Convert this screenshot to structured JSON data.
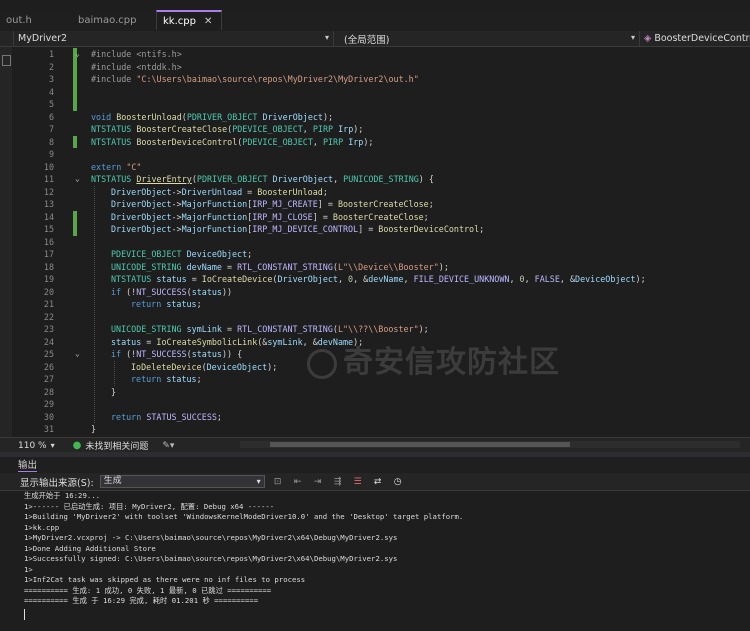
{
  "tabs": [
    {
      "label": "out.h",
      "active": false
    },
    {
      "label": "baimao.cpp",
      "active": false
    },
    {
      "label": "kk.cpp",
      "active": true
    }
  ],
  "navbar": {
    "project": "MyDriver2",
    "scope": "(全局范围)",
    "member": "BoosterDeviceControl"
  },
  "code_lines": [
    {
      "n": "1",
      "changed": true,
      "fold": "-",
      "indent": 0,
      "html": "<span class='pp'>#include &lt;ntifs.h&gt;</span>"
    },
    {
      "n": "2",
      "changed": true,
      "fold": "",
      "indent": 0,
      "html": "<span class='pp'>#include &lt;ntddk.h&gt;</span>"
    },
    {
      "n": "3",
      "changed": true,
      "fold": "",
      "indent": 0,
      "html": "<span class='pp'>#include </span><span class='str'>\"C:\\Users\\baimao\\source\\repos\\MyDriver2\\MyDriver2\\out.h\"</span>"
    },
    {
      "n": "4",
      "changed": true,
      "fold": "",
      "indent": 0,
      "html": ""
    },
    {
      "n": "5",
      "changed": true,
      "fold": "",
      "indent": 0,
      "html": ""
    },
    {
      "n": "6",
      "changed": false,
      "fold": "",
      "indent": 0,
      "html": "<span class='kw'>void</span> <span class='fn'>BoosterUnload</span>(<span class='ty'>PDRIVER_OBJECT</span> <span class='par'>DriverObject</span>);"
    },
    {
      "n": "7",
      "changed": false,
      "fold": "",
      "indent": 0,
      "html": "<span class='ty'>NTSTATUS</span> <span class='fn'>BoosterCreateClose</span>(<span class='ty'>PDEVICE_OBJECT</span>, <span class='ty'>PIRP</span> <span class='par'>Irp</span>);"
    },
    {
      "n": "8",
      "changed": true,
      "fold": "",
      "indent": 0,
      "html": "<span class='ty'>NTSTATUS</span> <span class='fn'>BoosterDeviceControl</span>(<span class='ty'>PDEVICE_OBJECT</span>, <span class='ty'>PIRP</span> <span class='par'>Irp</span>);"
    },
    {
      "n": "9",
      "changed": false,
      "fold": "",
      "indent": 0,
      "html": ""
    },
    {
      "n": "10",
      "changed": false,
      "fold": "",
      "indent": 0,
      "html": "<span class='kw'>extern</span> <span class='str'>\"C\"</span>"
    },
    {
      "n": "11",
      "changed": false,
      "fold": "-",
      "indent": 0,
      "html": "<span class='ty'>NTSTATUS</span> <span class='fn' style='text-decoration:underline'>DriverEntry</span>(<span class='ty'>PDRIVER_OBJECT</span> <span class='par'>DriverObject</span>, <span class='ty'>PUNICODE_STRING</span>) {"
    },
    {
      "n": "12",
      "changed": false,
      "fold": "",
      "indent": 1,
      "html": "<span class='par'>DriverObject</span>-&gt;<span class='par'>DriverUnload</span> = <span class='fn'>BoosterUnload</span>;"
    },
    {
      "n": "13",
      "changed": false,
      "fold": "",
      "indent": 1,
      "html": "<span class='par'>DriverObject</span>-&gt;<span class='par'>MajorFunction</span>[<span class='mac'>IRP_MJ_CREATE</span>] = <span class='fn'>BoosterCreateClose</span>;"
    },
    {
      "n": "14",
      "changed": true,
      "fold": "",
      "indent": 1,
      "html": "<span class='par'>DriverObject</span>-&gt;<span class='par'>MajorFunction</span>[<span class='mac'>IRP_MJ_CLOSE</span>] = <span class='fn'>BoosterCreateClose</span>;"
    },
    {
      "n": "15",
      "changed": true,
      "fold": "",
      "indent": 1,
      "html": "<span class='par'>DriverObject</span>-&gt;<span class='par'>MajorFunction</span>[<span class='mac'>IRP_MJ_DEVICE_CONTROL</span>] = <span class='fn'>BoosterDeviceControl</span>;"
    },
    {
      "n": "16",
      "changed": false,
      "fold": "",
      "indent": 1,
      "html": ""
    },
    {
      "n": "17",
      "changed": false,
      "fold": "",
      "indent": 1,
      "html": "<span class='ty'>PDEVICE_OBJECT</span> <span class='par'>DeviceObject</span>;"
    },
    {
      "n": "18",
      "changed": false,
      "fold": "",
      "indent": 1,
      "html": "<span class='ty'>UNICODE_STRING</span> <span class='par'>devName</span> = <span class='mac'>RTL_CONSTANT_STRING</span>(<span class='str'>L\"\\\\Device\\\\Booster\"</span>);"
    },
    {
      "n": "19",
      "changed": false,
      "fold": "",
      "indent": 1,
      "html": "<span class='ty'>NTSTATUS</span> <span class='par'>status</span> = <span class='fn'>IoCreateDevice</span>(<span class='par'>DriverObject</span>, <span class='num'>0</span>, &amp;<span class='par'>devName</span>, <span class='mac'>FILE_DEVICE_UNKNOWN</span>, <span class='num'>0</span>, <span class='mac'>FALSE</span>, &amp;<span class='par'>DeviceObject</span>);"
    },
    {
      "n": "20",
      "changed": false,
      "fold": "",
      "indent": 1,
      "html": "<span class='kw'>if</span> (!<span class='mac'>NT_SUCCESS</span>(<span class='par'>status</span>))"
    },
    {
      "n": "21",
      "changed": false,
      "fold": "",
      "indent": 2,
      "html": "<span class='kw'>return</span> <span class='par'>status</span>;"
    },
    {
      "n": "22",
      "changed": false,
      "fold": "",
      "indent": 1,
      "html": ""
    },
    {
      "n": "23",
      "changed": false,
      "fold": "",
      "indent": 1,
      "html": "<span class='ty'>UNICODE_STRING</span> <span class='par'>symLink</span> = <span class='mac'>RTL_CONSTANT_STRING</span>(<span class='str'>L\"\\\\??\\\\Booster\"</span>);"
    },
    {
      "n": "24",
      "changed": false,
      "fold": "",
      "indent": 1,
      "html": "<span class='par'>status</span> = <span class='fn'>IoCreateSymbolicLink</span>(&amp;<span class='par'>symLink</span>, &amp;<span class='par'>devName</span>);"
    },
    {
      "n": "25",
      "changed": false,
      "fold": "-",
      "indent": 1,
      "html": "<span class='kw'>if</span> (!<span class='mac'>NT_SUCCESS</span>(<span class='par'>status</span>)) {"
    },
    {
      "n": "26",
      "changed": false,
      "fold": "",
      "indent": 2,
      "html": "<span class='fn'>IoDeleteDevice</span>(<span class='par'>DeviceObject</span>);"
    },
    {
      "n": "27",
      "changed": false,
      "fold": "",
      "indent": 2,
      "html": "<span class='kw'>return</span> <span class='par'>status</span>;"
    },
    {
      "n": "28",
      "changed": false,
      "fold": "",
      "indent": 1,
      "html": "}"
    },
    {
      "n": "29",
      "changed": false,
      "fold": "",
      "indent": 1,
      "html": ""
    },
    {
      "n": "30",
      "changed": false,
      "fold": "",
      "indent": 1,
      "html": "<span class='kw'>return</span> <span class='mac'>STATUS_SUCCESS</span>;"
    },
    {
      "n": "31",
      "changed": false,
      "fold": "",
      "indent": 0,
      "html": "}"
    }
  ],
  "watermark": "奇安信攻防社区",
  "statusbar": {
    "zoom": "110 %",
    "issues": "未找到相关问题"
  },
  "output_panel": {
    "title": "输出",
    "source_label": "显示输出来源(S):",
    "source_value": "生成",
    "lines": [
      "生成开始于 16:29...",
      "1>------ 已启动生成: 项目: MyDriver2, 配置: Debug x64 ------",
      "1>Building 'MyDriver2' with toolset 'WindowsKernelModeDriver10.0' and the 'Desktop' target platform.",
      "1>kk.cpp",
      "1>MyDriver2.vcxproj -> C:\\Users\\baimao\\source\\repos\\MyDriver2\\x64\\Debug\\MyDriver2.sys",
      "1>Done Adding Additional Store",
      "1>Successfully signed: C:\\Users\\baimao\\source\\repos\\MyDriver2\\x64\\Debug\\MyDriver2.sys",
      "1>",
      "1>Inf2Cat task was skipped as there were no inf files to process",
      "========== 生成: 1 成功, 0 失败, 1 最新, 0 已跳过 ==========",
      "========== 生成 于 16:29 完成, 耗时 01.201 秒 =========="
    ]
  },
  "colors": {
    "accent": "#a97ee8",
    "change_bar": "#57a64a",
    "keyword": "#569cd6",
    "type": "#4ec9b0",
    "function": "#dcdcaa",
    "string": "#d69d85",
    "macro": "#beb7ff",
    "param": "#9cdcfe"
  }
}
